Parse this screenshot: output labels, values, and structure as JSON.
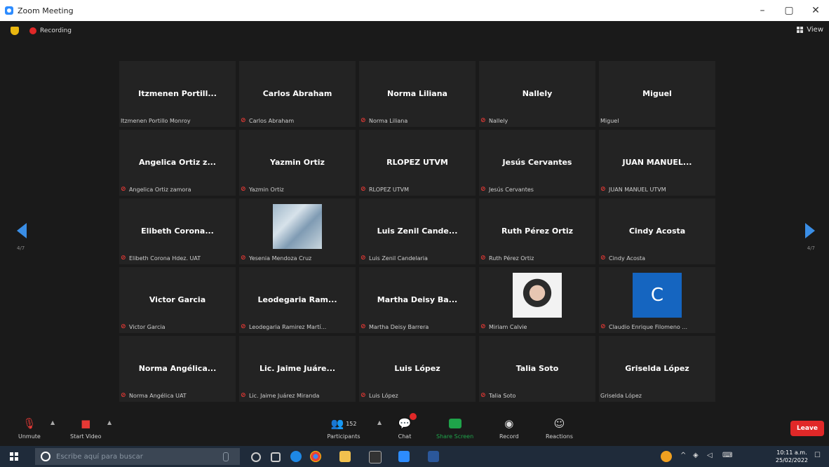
{
  "window": {
    "title": "Zoom Meeting",
    "controls": [
      "–",
      "▢",
      "✕"
    ]
  },
  "recording": {
    "label": "Recording"
  },
  "view": {
    "label": "View"
  },
  "pagination": {
    "left": "4/7",
    "right": "4/7"
  },
  "tiles": [
    {
      "name": "Itzmenen  Portill...",
      "label": "Itzmenen Portillo Monroy",
      "muted": false
    },
    {
      "name": "Carlos Abraham",
      "label": "Carlos Abraham",
      "muted": true
    },
    {
      "name": "Norma Liliana",
      "label": "Norma Liliana",
      "muted": true
    },
    {
      "name": "Nallely",
      "label": "Nallely",
      "muted": true
    },
    {
      "name": "Miguel",
      "label": "Miguel",
      "muted": false
    },
    {
      "name": "Angelica  Ortiz  z...",
      "label": "Angelica Ortiz zamora",
      "muted": true
    },
    {
      "name": "Yazmin Ortiz",
      "label": "Yazmin Ortiz",
      "muted": true
    },
    {
      "name": "RLOPEZ UTVM",
      "label": "RLOPEZ UTVM",
      "muted": true
    },
    {
      "name": "Jesús Cervantes",
      "label": "Jesús Cervantes",
      "muted": true
    },
    {
      "name": "JUAN  MANUEL...",
      "label": "JUAN MANUEL UTVM",
      "muted": true
    },
    {
      "name": "Elibeth  Corona...",
      "label": "Elibeth Corona Hdez. UAT",
      "muted": true
    },
    {
      "name": "",
      "label": "Yesenia Mendoza Cruz",
      "muted": true,
      "photo": "baby"
    },
    {
      "name": "Luis  Zenil  Cande...",
      "label": "Luis Zenil Candelaria",
      "muted": true
    },
    {
      "name": "Ruth Pérez Ortiz",
      "label": "Ruth Pérez Ortiz",
      "muted": true
    },
    {
      "name": "Cindy Acosta",
      "label": "Cindy Acosta",
      "muted": true
    },
    {
      "name": "Victor Garcia",
      "label": "Victor Garcia",
      "muted": true
    },
    {
      "name": "Leodegaria  Ram...",
      "label": "Leodegaria Ramirez Martí...",
      "muted": true
    },
    {
      "name": "Martha  Deisy  Ba...",
      "label": "Martha Deisy Barrera",
      "muted": true
    },
    {
      "name": "",
      "label": "Miriam Calvie",
      "muted": true,
      "photo": "woman"
    },
    {
      "name": "",
      "label": "Claudio Enrique Filomeno ...",
      "muted": true,
      "avatar": "C"
    },
    {
      "name": "Norma  Angélica...",
      "label": "Norma Angélica UAT",
      "muted": true
    },
    {
      "name": "Lic.  Jaime  Juáre...",
      "label": "Lic. Jaime Juárez Miranda",
      "muted": true
    },
    {
      "name": "Luis López",
      "label": "Luis López",
      "muted": true
    },
    {
      "name": "Talia Soto",
      "label": "Talia Soto",
      "muted": true
    },
    {
      "name": "Griselda López",
      "label": "Griselda López",
      "muted": false
    }
  ],
  "toolbar": {
    "unmute": "Unmute",
    "start_video": "Start Video",
    "participants": "Participants",
    "participants_count": "152",
    "chat": "Chat",
    "share_screen": "Share Screen",
    "record": "Record",
    "reactions": "Reactions",
    "leave": "Leave"
  },
  "taskbar": {
    "search_placeholder": "Escribe aquí para buscar",
    "time": "10:11 a.m.",
    "date": "25/02/2022"
  },
  "colors": {
    "accent": "#2d8cff",
    "leave": "#e02828",
    "share": "#1fa34a",
    "muted": "#e53935",
    "avatar": "#1565c0"
  }
}
